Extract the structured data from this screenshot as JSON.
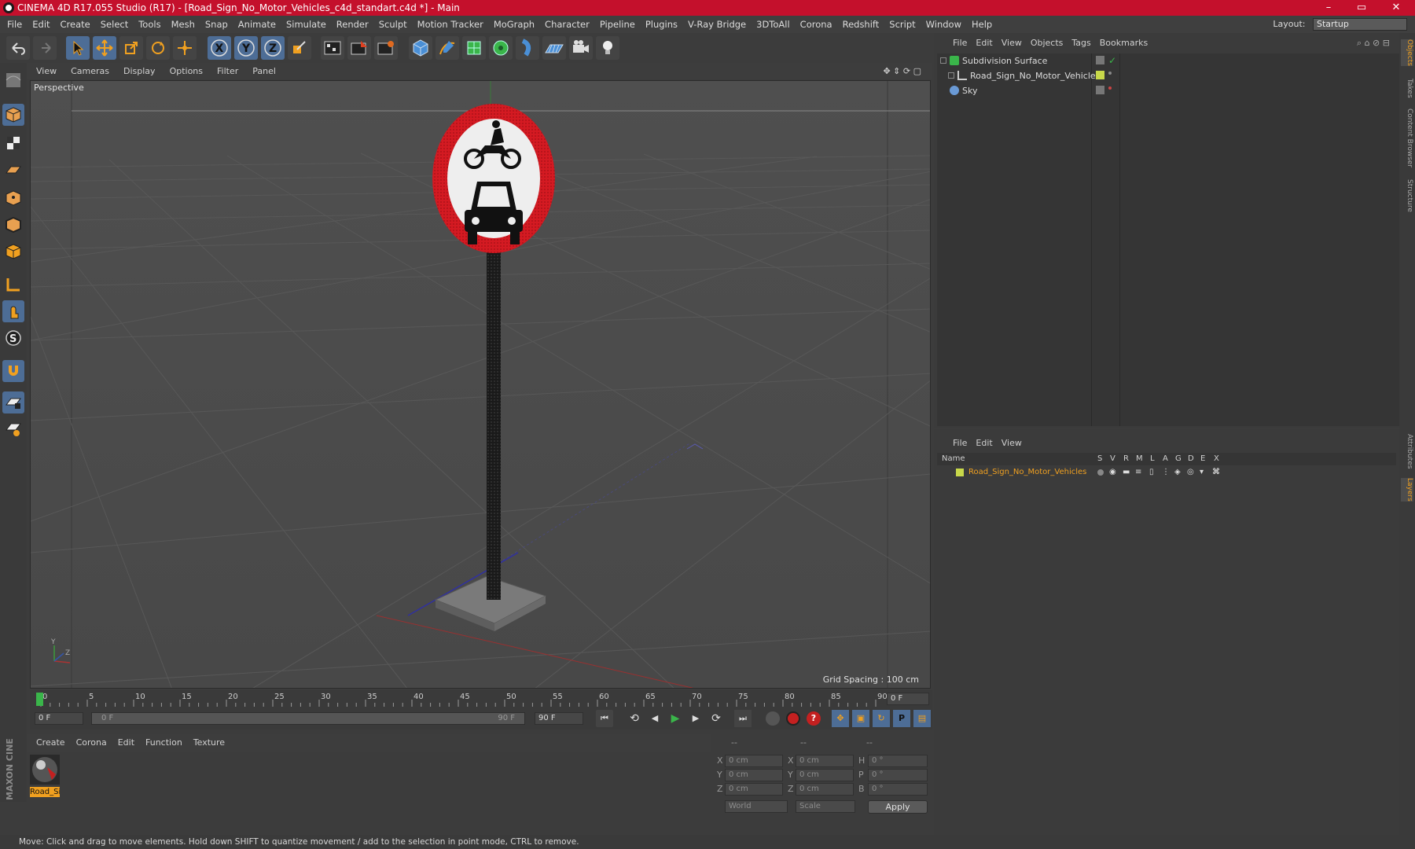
{
  "window": {
    "title": "CINEMA 4D R17.055 Studio (R17) - [Road_Sign_No_Motor_Vehicles_c4d_standart.c4d *] - Main",
    "minimize": "–",
    "maximize": "▭",
    "close": "✕"
  },
  "menu": {
    "items": [
      "File",
      "Edit",
      "Create",
      "Select",
      "Tools",
      "Mesh",
      "Snap",
      "Animate",
      "Simulate",
      "Render",
      "Sculpt",
      "Motion Tracker",
      "MoGraph",
      "Character",
      "Pipeline",
      "Plugins",
      "V-Ray Bridge",
      "3DToAll",
      "Corona",
      "Redshift",
      "Script",
      "Window",
      "Help"
    ],
    "layout_label": "Layout:",
    "layout_value": "Startup"
  },
  "viewport": {
    "menu": [
      "View",
      "Cameras",
      "Display",
      "Options",
      "Filter",
      "Panel"
    ],
    "label": "Perspective",
    "grid_spacing": "Grid Spacing : 100 cm"
  },
  "timeline": {
    "ticks": [
      "0",
      "5",
      "10",
      "15",
      "20",
      "25",
      "30",
      "35",
      "40",
      "45",
      "50",
      "55",
      "60",
      "65",
      "70",
      "75",
      "80",
      "85",
      "90"
    ],
    "current_frame": "0 F",
    "start_field": "0 F",
    "range_start": "0 F",
    "range_end": "90 F",
    "end_field": "90 F"
  },
  "material_panel": {
    "menu": [
      "Create",
      "Corona",
      "Edit",
      "Function",
      "Texture"
    ],
    "material_name": "Road_Si"
  },
  "coordinates": {
    "header": [
      "--",
      "--",
      "--"
    ],
    "rows": [
      {
        "a": "X",
        "av": "0 cm",
        "b": "X",
        "bv": "0 cm",
        "c": "H",
        "cv": "0 °"
      },
      {
        "a": "Y",
        "av": "0 cm",
        "b": "Y",
        "bv": "0 cm",
        "c": "P",
        "cv": "0 °"
      },
      {
        "a": "Z",
        "av": "0 cm",
        "b": "Z",
        "bv": "0 cm",
        "c": "B",
        "cv": "0 °"
      }
    ],
    "world": "World",
    "scale": "Scale",
    "apply": "Apply"
  },
  "object_manager": {
    "menu": [
      "File",
      "Edit",
      "View",
      "Objects",
      "Tags",
      "Bookmarks"
    ],
    "objects": [
      "Subdivision Surface",
      "Road_Sign_No_Motor_Vehicles",
      "Sky"
    ]
  },
  "layer_manager": {
    "menu": [
      "File",
      "Edit",
      "View"
    ],
    "columns": [
      "Name",
      "S",
      "V",
      "R",
      "M",
      "L",
      "A",
      "G",
      "D",
      "E",
      "X"
    ],
    "layer_name": "Road_Sign_No_Motor_Vehicles"
  },
  "right_tabs": [
    "Objects",
    "Takes",
    "Content Browser",
    "Structure",
    "Attributes",
    "Layers"
  ],
  "branding": "MAXON CINEMA 4D",
  "status": "Move: Click and drag to move elements. Hold down SHIFT to quantize movement / add to the selection in point mode, CTRL to remove.",
  "colors": {
    "title_bar": "#c4102c",
    "accent": "#f0a020",
    "layer_color": "#c8d84a"
  }
}
